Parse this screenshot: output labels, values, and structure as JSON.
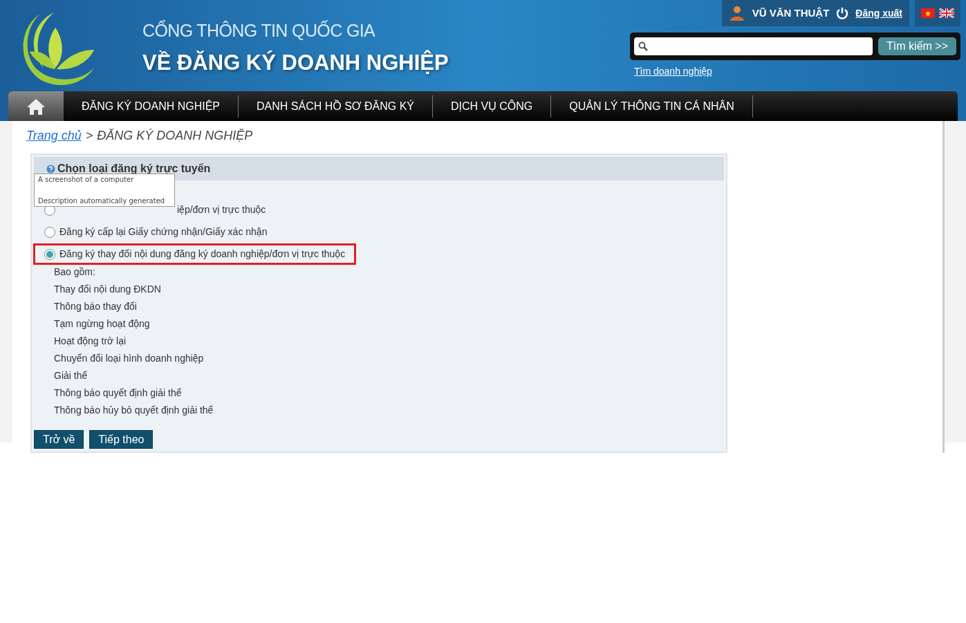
{
  "header": {
    "title_line1": "CỔNG THÔNG TIN QUỐC GIA",
    "title_line2": "VỀ ĐĂNG KÝ DOANH NGHIỆP",
    "user_name": "VŨ VĂN THUẬT",
    "logout": "Đăng xuất",
    "search": {
      "button": "Tìm kiếm >>"
    },
    "search_link": "Tìm doanh nghiệp"
  },
  "nav": [
    {
      "label": "ĐĂNG KÝ DOANH NGHIỆP"
    },
    {
      "label": "DANH SÁCH HỒ SƠ ĐĂNG KÝ"
    },
    {
      "label": "DỊCH VỤ CÔNG"
    },
    {
      "label": "QUẢN LÝ THÔNG TIN CÁ NHÂN"
    }
  ],
  "breadcrumb": {
    "home": "Trang chủ",
    "separator": ">",
    "current": "ĐĂNG KÝ DOANH NGHIỆP"
  },
  "panel": {
    "title": "Chọn loại đăng ký trực tuyến",
    "options": [
      {
        "label": "iệp/đơn vị trực thuộc",
        "selected": false,
        "highlighted": false
      },
      {
        "label": "Đăng ký cấp lại Giấy chứng nhận/Giấy xác nhận",
        "selected": false,
        "highlighted": false
      },
      {
        "label": "Đăng ký thay đổi nội dung đăng ký doanh nghiệp/đơn vị trực thuộc",
        "selected": true,
        "highlighted": true
      }
    ],
    "includes_label": "Bao gồm:",
    "includes": [
      "Thay đổi nội dung ĐKDN",
      "Thông báo thay đổi",
      "Tạm ngừng hoạt động",
      "Hoạt động trở lại",
      "Chuyển đổi loại hình doanh nghiệp",
      "Giải thể",
      "Thông báo quyết định giải thể",
      "Thông báo hủy bỏ quyết định giải thể"
    ],
    "buttons": [
      "Trở về",
      "Tiếp theo"
    ]
  },
  "alt_text_tooltip": {
    "line1": "A screenshot of a computer",
    "line2": "Description automatically generated"
  }
}
